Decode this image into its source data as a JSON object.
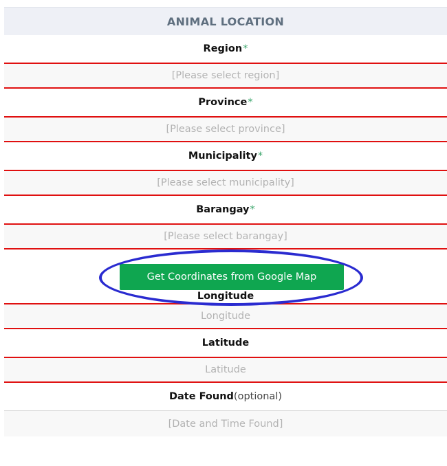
{
  "section": {
    "title": "ANIMAL LOCATION"
  },
  "fields": {
    "region": {
      "label": "Region",
      "required_mark": "*",
      "placeholder": "[Please select region]"
    },
    "province": {
      "label": "Province",
      "required_mark": "*",
      "placeholder": "[Please select province]"
    },
    "municipality": {
      "label": "Municipality",
      "required_mark": "*",
      "placeholder": "[Please select municipality]"
    },
    "barangay": {
      "label": "Barangay",
      "required_mark": "*",
      "placeholder": "[Please select barangay]"
    },
    "longitude": {
      "label": "Longitude",
      "placeholder": "Longitude"
    },
    "latitude": {
      "label": "Latitude",
      "placeholder": "Latitude"
    },
    "date_found": {
      "label": "Date Found",
      "optional_note": "(optional)",
      "placeholder": "[Date and Time Found]"
    }
  },
  "map_button": {
    "label": "Get Coordinates from Google Map"
  },
  "colors": {
    "button_green": "#0fa650",
    "field_border_red": "#e01010",
    "highlight_blue": "#2a2bd0",
    "required_green": "#3aa56b"
  }
}
